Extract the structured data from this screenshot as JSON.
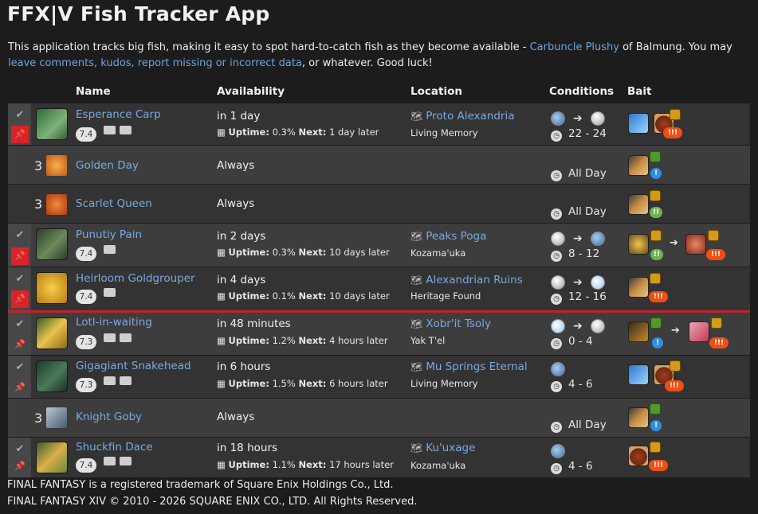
{
  "app": {
    "title": "FFX|V Fish Tracker App",
    "intro_text": "This application tracks big fish, making it easy to spot hard-to-catch fish as they become available - ",
    "author_link": "Carbuncle Plushy",
    "intro_middle": " of Balmung. You may ",
    "feedback_link": "leave comments, kudos, report missing or incorrect data",
    "intro_end": ", or whatever. Good luck!"
  },
  "columns": {
    "name": "Name",
    "availability": "Availability",
    "location": "Location",
    "conditions": "Conditions",
    "bait": "Bait"
  },
  "labels": {
    "uptime": "Uptime:",
    "next": "Next:"
  },
  "fish": [
    {
      "name": "Esperance Carp",
      "patch": "7.4",
      "avail": "in 1 day",
      "uptime": "0.3%",
      "next": "1 day later",
      "location": "Proto Alexandria",
      "sublocation": "Living Memory",
      "weather": [
        "rain",
        "cloud"
      ],
      "time": "22 - 24",
      "pinned": true,
      "has_video": true
    },
    {
      "name": "Golden Day",
      "count": "3",
      "avail": "Always",
      "time": "All Day"
    },
    {
      "name": "Scarlet Queen",
      "count": "3",
      "avail": "Always",
      "time": "All Day"
    },
    {
      "name": "Punutiy Pain",
      "patch": "7.4",
      "avail": "in 2 days",
      "uptime": "0.3%",
      "next": "10 days later",
      "location": "Peaks Poga",
      "sublocation": "Kozama'uka",
      "weather": [
        "cloud",
        "rain"
      ],
      "time": "8 - 12",
      "pinned": true,
      "has_video": false
    },
    {
      "name": "Heirloom Goldgrouper",
      "patch": "7.4",
      "avail": "in 4 days",
      "uptime": "0.1%",
      "next": "10 days later",
      "location": "Alexandrian Ruins",
      "sublocation": "Heritage Found",
      "weather": [
        "cloud",
        "clear"
      ],
      "time": "12 - 16",
      "pinned": true,
      "has_video": false
    },
    {
      "name": "Lotl-in-waiting",
      "patch": "7.3",
      "avail": "in 48 minutes",
      "uptime": "1.2%",
      "next": "4 hours later",
      "location": "Xobr'it Tsoly",
      "sublocation": "Yak T'el",
      "weather": [
        "clear",
        "cloud"
      ],
      "time": "0 - 4",
      "pinned": false,
      "has_video": true
    },
    {
      "name": "Gigagiant Snakehead",
      "patch": "7.3",
      "avail": "in 6 hours",
      "uptime": "1.5%",
      "next": "6 hours later",
      "location": "Mu Springs Eternal",
      "sublocation": "Living Memory",
      "weather": [
        "rain"
      ],
      "time": "4 - 6",
      "pinned": false,
      "has_video": true
    },
    {
      "name": "Knight Goby",
      "count": "3",
      "avail": "Always",
      "time": "All Day"
    },
    {
      "name": "Shuckfin Dace",
      "patch": "7.4",
      "avail": "in 18 hours",
      "uptime": "1.1%",
      "next": "17 hours later",
      "location": "Ku'uxage",
      "sublocation": "Kozama'uka",
      "weather": [
        "rain"
      ],
      "time": "4 - 6",
      "pinned": false,
      "has_video": true
    }
  ],
  "tug_labels": {
    "heavy": "!!!",
    "medium": "!!",
    "light": "!"
  },
  "icons": {
    "check": "check-icon",
    "pin": "pin-icon",
    "map": "map-icon",
    "clock": "clock-icon",
    "calendar": "calendar-icon",
    "video": "video-icon",
    "list": "list-icon",
    "arrow": "arrow-right-icon"
  },
  "colors": {
    "background": "#1c1c1c",
    "row_odd": "#333333",
    "row_even": "#3d3d3d",
    "link": "#6fa3dc",
    "pin_active": "#d7242a",
    "divider": "#c0222a",
    "tug_heavy": "#ef4f12",
    "tug_light": "#2d8ee6",
    "tug_medium": "#6fb254"
  },
  "footer": {
    "line1": "FINAL FANTASY is a registered trademark of Square Enix Holdings Co., Ltd.",
    "line2": "FINAL FANTASY XIV © 2010 - 2026 SQUARE ENIX CO., LTD. All Rights Reserved."
  }
}
